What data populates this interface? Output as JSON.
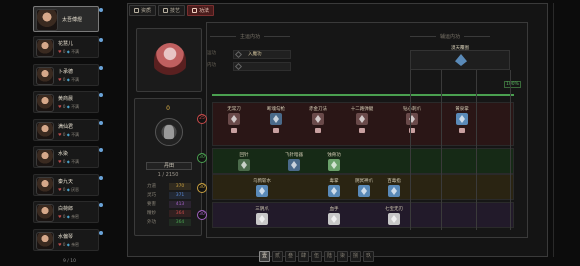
{
  "party": {
    "members": [
      {
        "name": "太吾傅煜",
        "selected": true
      },
      {
        "name": "花慧儿",
        "stat_a": "0",
        "stat_b": "不满"
      },
      {
        "name": "卜承德",
        "stat_a": "0",
        "stat_b": "不满"
      },
      {
        "name": "黄商晨",
        "stat_a": "0",
        "stat_b": "不满"
      },
      {
        "name": "满仙君",
        "stat_a": "0",
        "stat_b": "不满"
      },
      {
        "name": "水染",
        "stat_a": "0",
        "stat_b": "不满"
      },
      {
        "name": "秦九天",
        "stat_a": "0",
        "stat_b": "厌恶"
      },
      {
        "name": "白荷郎",
        "stat_a": "0",
        "stat_b": "亲密"
      },
      {
        "name": "水偏琴",
        "stat_a": "0",
        "stat_b": "亲密"
      }
    ],
    "count": "9 / 10"
  },
  "tabs": [
    {
      "label": "资质",
      "active": false
    },
    {
      "label": "技艺",
      "active": false
    },
    {
      "label": "功法",
      "active": true
    }
  ],
  "character": {
    "level": "0",
    "name": "丹田",
    "exp": "1 / 2150",
    "stats": [
      {
        "label": "力道",
        "value": "370",
        "color": "#c8a040"
      },
      {
        "label": "灵巧",
        "value": "371",
        "color": "#5a8ad8"
      },
      {
        "label": "要害",
        "value": "413",
        "color": "#a060c0"
      },
      {
        "label": "精妙",
        "value": "364",
        "color": "#c84a4a"
      },
      {
        "label": "外功",
        "value": "364",
        "color": "#4aa050"
      }
    ]
  },
  "panel": {
    "main_header": "主运内功",
    "aux_header": "辅运内功",
    "slot1_label": "运功",
    "slot1_value": "入魔功",
    "slot2_label": "内功",
    "slot2_value": "",
    "ultimate_name": "漠天覆图",
    "progress_pct": "100%",
    "progress_fraction": 1.0
  },
  "tiers": [
    {
      "value": "25",
      "color": "#c84a4a"
    },
    {
      "value": "30",
      "color": "#4aa050"
    },
    {
      "value": "30",
      "color": "#c8a040"
    },
    {
      "value": "30",
      "color": "#a060c0"
    }
  ],
  "skills": {
    "row1": [
      {
        "name": "无常刀",
        "color": "#6a4a4a"
      },
      {
        "name": "断魂勾枪",
        "color": "#4a6a8a"
      },
      {
        "name": "赤金刀法",
        "color": "#6a4a4a"
      },
      {
        "name": "十二路弹腿",
        "color": "#6a4a4a"
      },
      {
        "name": "钻心刺爪",
        "color": "#6a4a4a"
      },
      {
        "name": "黄泉掌",
        "color": "#5a8ab8"
      }
    ],
    "row2": [
      {
        "name": "回针",
        "color": "#4a6a4a"
      },
      {
        "name": "飞针暗器",
        "color": "#4a6a8a"
      },
      {
        "name": "蚀骨功",
        "color": "#6aa06a"
      }
    ],
    "row3": [
      {
        "name": "乌鸦斩水",
        "color": "#5a8ab8"
      },
      {
        "name": "毒掌",
        "color": "#5a8ab8"
      },
      {
        "name": "阴冥神爪",
        "color": "#5a8ab8"
      },
      {
        "name": "百毒指",
        "color": "#5a8ab8"
      }
    ],
    "row4": [
      {
        "name": "三阴爪",
        "color": "#c8c8c8"
      },
      {
        "name": "血手",
        "color": "#c8c8c8"
      },
      {
        "name": "七宝无刃",
        "color": "#c8c8c8"
      }
    ]
  },
  "pager": [
    "壹",
    "贰",
    "叁",
    "肆",
    "伍",
    "陆",
    "柒",
    "捌",
    "玖"
  ],
  "pager_active": 0
}
